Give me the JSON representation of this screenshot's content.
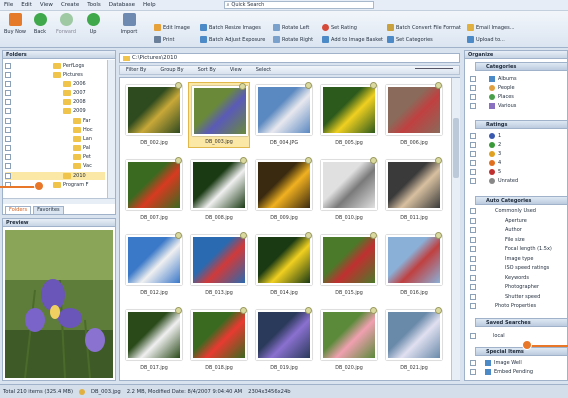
{
  "menu": [
    "File",
    "Edit",
    "View",
    "Create",
    "Tools",
    "Database",
    "Help"
  ],
  "quick_search": {
    "placeholder": "Quick Search"
  },
  "toolbar": {
    "big": [
      "Buy Now",
      "Back",
      "Forward",
      "Up",
      "Import"
    ],
    "small": [
      "Edit Image",
      "Print",
      "Batch Resize Images",
      "Batch Adjust Exposure",
      "Rotate Left",
      "Rotate Right",
      "Set Rating",
      "Add to Image Basket",
      "Batch Convert File Format",
      "Set Categories",
      "Email Images...",
      "Upload to..."
    ]
  },
  "folders": {
    "title": "Folders",
    "items": [
      "PerfLogs",
      "Pictures",
      "2006",
      "2007",
      "2008",
      "2009",
      "Far",
      "Hoc",
      "Lan",
      "Pal",
      "Pet",
      "Vac",
      "2010",
      "Program F"
    ],
    "tabs": [
      "Folders",
      "Favorites"
    ]
  },
  "preview": {
    "title": "Preview"
  },
  "address": "C:\\Pictures\\2010",
  "view_bar": [
    "Filter By",
    "Group By",
    "Sort By",
    "View",
    "Select"
  ],
  "thumbs": [
    "DB_002.jpg",
    "DB_003.jpg",
    "DB_004.JPG",
    "DB_005.jpg",
    "DB_006.jpg",
    "DB_007.jpg",
    "DB_008.jpg",
    "DB_009.jpg",
    "DB_010.jpg",
    "DB_011.jpg",
    "DB_012.jpg",
    "DB_013.jpg",
    "DB_014.jpg",
    "DB_015.jpg",
    "DB_016.jpg",
    "DB_017.jpg",
    "DB_018.jpg",
    "DB_019.jpg",
    "DB_020.jpg",
    "DB_021.jpg"
  ],
  "organize": {
    "title": "Organize",
    "categories_title": "Categories",
    "categories": [
      "Albums",
      "People",
      "Places",
      "Various"
    ],
    "ratings_title": "Ratings",
    "ratings": [
      "1",
      "2",
      "3",
      "4",
      "5",
      "Unrated"
    ],
    "auto_title": "Auto Categories",
    "auto": [
      "Commonly Used",
      "Aperture",
      "Author",
      "File size",
      "Focal length (1.5x)",
      "Image type",
      "ISO speed ratings",
      "Keywords",
      "Photographer",
      "Shutter speed",
      "Photo Properties"
    ],
    "saved_title": "Saved Searches",
    "saved": [
      "local"
    ],
    "special_title": "Special Items",
    "special": [
      "Image Well",
      "Embed Pending"
    ]
  },
  "status": {
    "total": "Total 210 items (325.4 MB)",
    "file": "DB_003.jpg",
    "info": "2.2 MB, Modified Date: 8/4/2007 9:04:40 AM",
    "dims": "2304x3456x24b"
  }
}
